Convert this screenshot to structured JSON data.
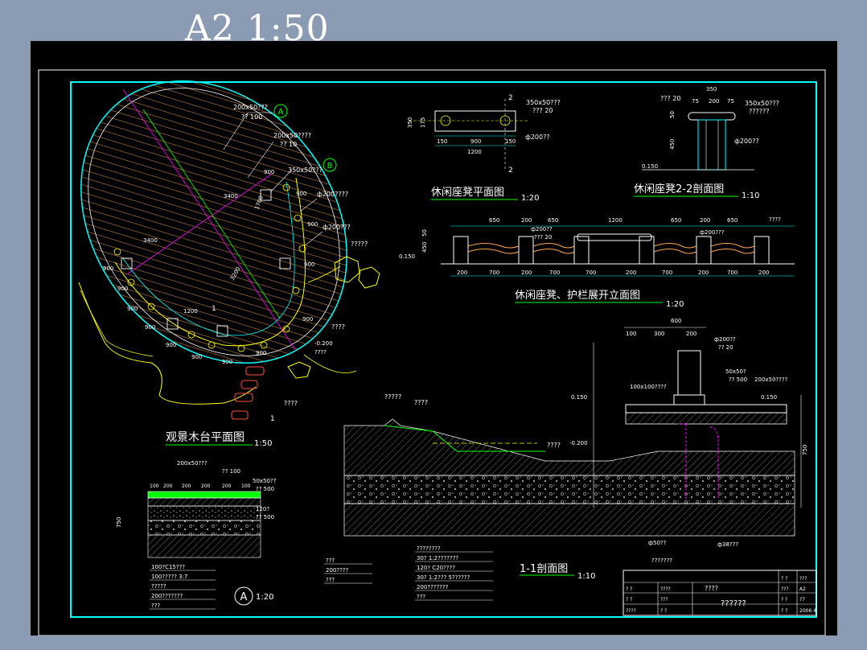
{
  "header": {
    "title": "A2 1:50"
  },
  "plan": {
    "title": "观景木台平面图",
    "scale": "1:50",
    "label_a": "200x50???",
    "label_a2": "?? 100",
    "label_b": "200x50????",
    "label_b2": "?? 10",
    "label_c": "350x50???",
    "label_d": "ф200????",
    "label_e": "ф200???",
    "label_rock": "?????",
    "label_stone": "????",
    "label_water": "????",
    "elev": "-0.200",
    "elev2": "????",
    "dims": [
      "900",
      "900",
      "900",
      "900",
      "900",
      "900",
      "900",
      "900",
      "900",
      "900",
      "900",
      "900",
      "900"
    ],
    "dim_3400": "3400",
    "dim_1200": "1200",
    "dim_3200": "3200",
    "dim_1700": "1700",
    "circle_a": "A",
    "circle_b": "B",
    "section_mark": "1"
  },
  "bench_plan": {
    "title": "休闲座凳平面图",
    "scale": "1:20",
    "label1": "350x50???",
    "label2": "??? 20",
    "label3": "ф200??",
    "d150": "150",
    "d900": "900",
    "d1200": "1200",
    "d350": "350",
    "d175": "175",
    "mark": "2"
  },
  "bench_section": {
    "title": "休闲座凳2-2剖面图",
    "scale": "1:10",
    "d350": "350",
    "d75": "75",
    "d200": "200",
    "label1": "??? 20",
    "label2": "350x50???",
    "label3": "??????",
    "label4": "ф200??",
    "d50": "50",
    "d450": "450",
    "elev": "0.150"
  },
  "elevation": {
    "title": "休闲座凳、护栏展开立面图",
    "scale": "1:20",
    "top_dims": [
      "650",
      "200",
      "650",
      "1200",
      "650",
      "200",
      "650"
    ],
    "bottom_dims": [
      "200",
      "700",
      "200",
      "700",
      "700",
      "200",
      "700",
      "200",
      "700",
      "200"
    ],
    "label1": "ф200??",
    "label2": "??? 20",
    "label3": "ф200???",
    "label4": "????",
    "elev": "0.150",
    "d450": "450",
    "d50": "50"
  },
  "detail_a": {
    "title": "A",
    "scale": "1:20",
    "labels": [
      "200x50???",
      "?? 100",
      "50x50??",
      "?? 500",
      "120?",
      "?? 500"
    ],
    "dims": [
      "100",
      "200",
      "200",
      "200",
      "200",
      "100"
    ],
    "notes": [
      "100?C15???",
      "100????? 3:7",
      "?????",
      "200???????",
      "???"
    ],
    "vdim": "750"
  },
  "section": {
    "title": "1-1剖面图",
    "scale": "1:10",
    "labels": [
      "?????",
      "????",
      "????",
      "-0.200",
      "100x100????",
      "0.150",
      "50x50?",
      "?? 500",
      "200x50????",
      "0.150",
      "ф200??",
      "?? 20"
    ],
    "top_dims": [
      "600",
      "100",
      "300",
      "200"
    ],
    "notes_left": [
      "???",
      "200????",
      "???"
    ],
    "notes_mid": [
      "????????",
      "30? 1:2???????",
      "120? C20????",
      "30? 1:2??? 5??????",
      "200???????",
      "???"
    ],
    "pipe1": "ф50??",
    "pipe2": "ф38???",
    "pipe3": "???????",
    "vdim": "750"
  },
  "title_block": {
    "project": "????",
    "drawing": "??????",
    "cells": [
      "? ?",
      "? ?",
      "????",
      "????",
      "???",
      "? ?",
      "? ?",
      "???",
      "???",
      "A2",
      "? ?",
      "?7",
      "? ?",
      "2006.4"
    ]
  },
  "colors": {
    "cad_cyan": "#00ffff",
    "cad_yellow": "#ffff00",
    "cad_green": "#00ff00",
    "cad_white": "#ffffff",
    "cad_magenta": "#ff00ff",
    "cad_orange": "#ffa64d",
    "cad_red": "#ff3030"
  }
}
